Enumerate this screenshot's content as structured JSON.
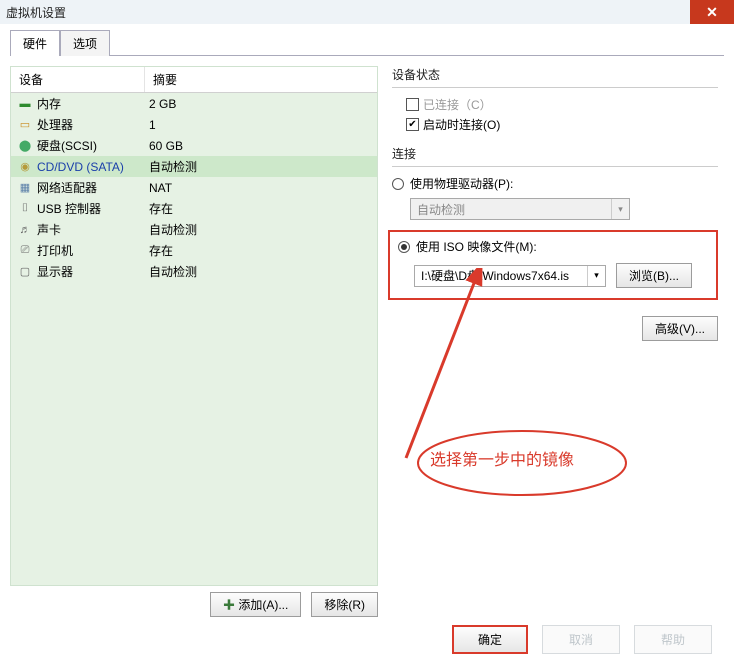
{
  "title": "虚拟机设置",
  "tabs": {
    "hardware": "硬件",
    "options": "选项"
  },
  "grid": {
    "head_device": "设备",
    "head_summary": "摘要",
    "rows": [
      {
        "icon": "▬",
        "name": "内存",
        "val": "2 GB"
      },
      {
        "icon": "▭",
        "name": "处理器",
        "val": "1"
      },
      {
        "icon": "⬤",
        "name": "硬盘(SCSI)",
        "val": "60 GB"
      },
      {
        "icon": "◉",
        "name": "CD/DVD (SATA)",
        "val": "自动检测"
      },
      {
        "icon": "▦",
        "name": "网络适配器",
        "val": "NAT"
      },
      {
        "icon": "⌷",
        "name": "USB 控制器",
        "val": "存在"
      },
      {
        "icon": "♬",
        "name": "声卡",
        "val": "自动检测"
      },
      {
        "icon": "⎚",
        "name": "打印机",
        "val": "存在"
      },
      {
        "icon": "▢",
        "name": "显示器",
        "val": "自动检测"
      }
    ]
  },
  "left_buttons": {
    "add": "添加(A)...",
    "remove": "移除(R)"
  },
  "right": {
    "status_title": "设备状态",
    "connected": "已连接（C）",
    "connect_on_power": "启动时连接(O)",
    "connection_title": "连接",
    "use_physical": "使用物理驱动器(P):",
    "auto_detect": "自动检测",
    "use_iso": "使用 ISO 映像文件(M):",
    "iso_path": "I:\\硬盘\\D盘\\Windows7x64.is",
    "browse": "浏览(B)...",
    "advanced": "高级(V)..."
  },
  "annotation": "选择第一步中的镜像",
  "footer": {
    "ok": "确定",
    "cancel": "取消",
    "help": "帮助"
  }
}
